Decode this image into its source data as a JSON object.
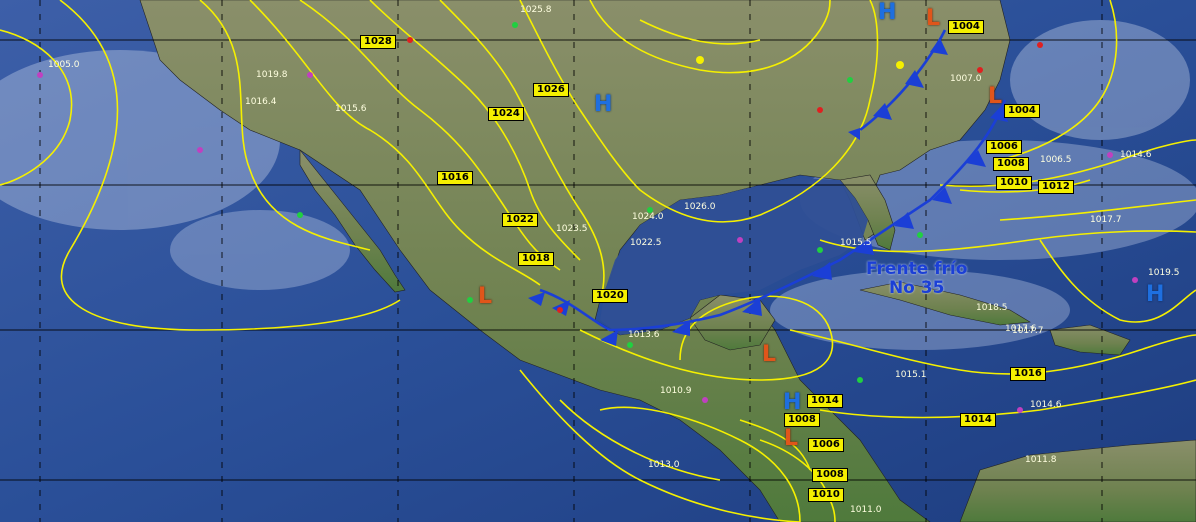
{
  "isobar_labels": [
    "1028",
    "1026",
    "1024",
    "1022",
    "1020",
    "1018",
    "1016",
    "1014",
    "1012",
    "1010",
    "1008",
    "1006",
    "1004",
    "1016",
    "1014",
    "1008",
    "1006",
    "1008",
    "1010",
    "1014"
  ],
  "pressure_centers": [
    {
      "type": "H",
      "label": "H"
    },
    {
      "type": "H",
      "label": "H"
    },
    {
      "type": "H",
      "label": "H"
    },
    {
      "type": "H",
      "label": "H"
    },
    {
      "type": "L",
      "label": "L"
    },
    {
      "type": "L",
      "label": "L"
    },
    {
      "type": "L",
      "label": "L"
    },
    {
      "type": "L",
      "label": "L"
    },
    {
      "type": "L",
      "label": "L"
    }
  ],
  "front": {
    "name_line1": "Frente frío",
    "name_line2": "No 35",
    "color": "#1b3fd6",
    "type": "cold-front"
  },
  "station_values": [
    "1005.0",
    "1019.8",
    "1016.4",
    "1015.6",
    "1025.8",
    "1023.5",
    "1022.5",
    "1024.0",
    "1026.0",
    "1017.6",
    "1015.5",
    "1013.6",
    "1011.0",
    "1018.5",
    "1017.7",
    "1014.6",
    "1015.1",
    "1017.7",
    "1019.5",
    "1006.5",
    "1007.0",
    "1014.6",
    "1011.8",
    "1010.9",
    "1013.0"
  ],
  "colors": {
    "isobar": "#f5f000",
    "ocean": "#2a4a8a",
    "land": "#7a8a5a",
    "grid": "#000000",
    "high": "#1e6fe0",
    "low": "#e0551a"
  }
}
